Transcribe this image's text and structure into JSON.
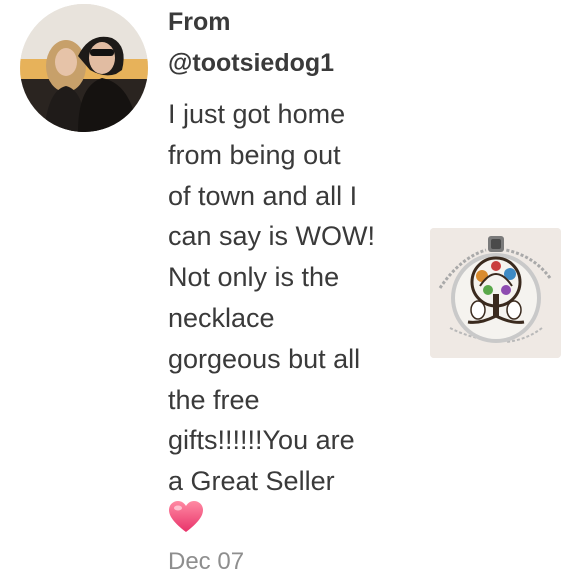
{
  "review": {
    "from_label": "From",
    "handle": "@tootsiedog1",
    "message_lines": [
      "I just got home",
      "from being out",
      "of town and all I",
      "can say is WOW!",
      "Not only is the",
      "necklace",
      "gorgeous but all",
      "the free",
      "gifts!!!!!!You are",
      "a Great Seller"
    ],
    "reaction_icon": "heart-emoji",
    "date": "Dec 07",
    "product_image_icon": "tree-of-life-pendant-necklace",
    "avatar_icon": "user-avatar-photo"
  }
}
